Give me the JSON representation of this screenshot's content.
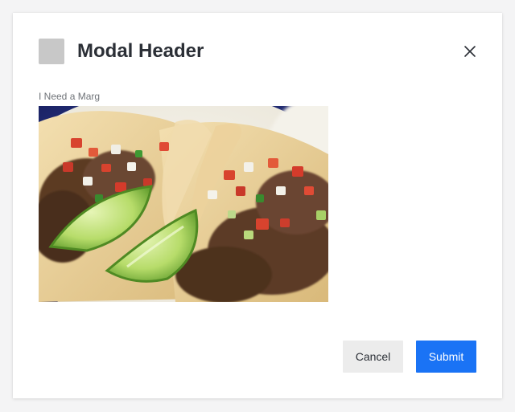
{
  "modal": {
    "title": "Modal Header",
    "image_caption": "I Need a Marg",
    "image_alt": "Tacos with pico de gallo and lime wedges",
    "cancel_label": "Cancel",
    "submit_label": "Submit",
    "icons": {
      "header": "image-placeholder-icon",
      "close": "close-icon"
    },
    "colors": {
      "primary": "#1a73f5",
      "secondary_bg": "#ececec",
      "title_text": "#2b2f36",
      "caption_text": "#6f7378",
      "placeholder": "#c8c8c8"
    }
  }
}
